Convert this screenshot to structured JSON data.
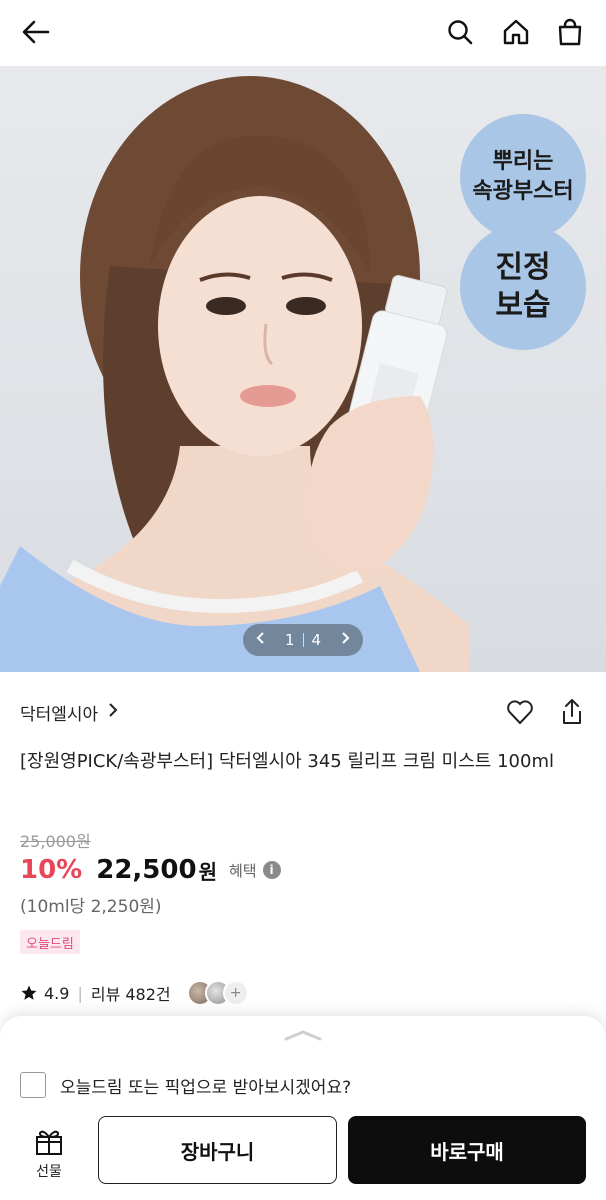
{
  "header": {
    "back_icon": "arrow-left-icon",
    "search_icon": "search-icon",
    "home_icon": "home-icon",
    "bag_icon": "shopping-bag-icon"
  },
  "hero": {
    "badge_1": "뿌리는\n속광부스터",
    "badge_2": "진정\n보습",
    "pager_current": "1",
    "pager_total": "4"
  },
  "product": {
    "brand": "닥터엘시아",
    "title": "[장원영PICK/속광부스터] 닥터엘시아 345 릴리프 크림 미스트 100ml",
    "original_price": "25,000원",
    "discount": "10%",
    "price": "22,500",
    "currency": "원",
    "benefit_label": "혜택",
    "unit_price": "(10ml당 2,250원)",
    "tag": "오늘드림",
    "rating": "4.9",
    "review_label": "리뷰 482건"
  },
  "sheet": {
    "delivery_label": "오늘드림 또는 픽업으로 받아보시겠어요?",
    "gift_label": "선물",
    "cart_label": "장바구니",
    "buy_label": "바로구매"
  },
  "colors": {
    "accent_discount": "#e8475a",
    "badge_blue": "#a9c6e6",
    "buy_button": "#0d0d0d",
    "tag_bg": "#fbe7ee",
    "tag_text": "#e0497a"
  }
}
